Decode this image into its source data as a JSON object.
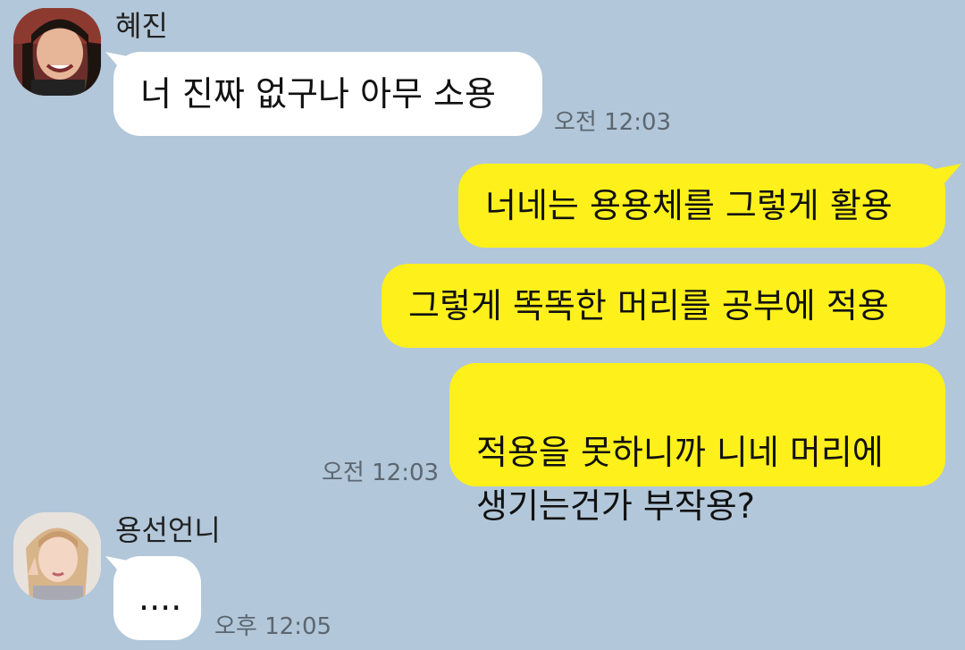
{
  "messages": [
    {
      "sender": "혜진",
      "text": "너 진짜 없구나 아무 소용",
      "time": "오전 12:03"
    },
    {
      "sender": "me",
      "lines": [
        "너네는 용용체를 그렇게 활용",
        "그렇게 똑똑한 머리를 공부에 적용",
        "적용을 못하니까 니네 머리에\n생기는건가 부작용?"
      ],
      "time": "오전 12:03"
    },
    {
      "sender": "용선언니",
      "text": "....",
      "time": "오후 12:05"
    }
  ],
  "avatars": {
    "hyejin": "profile-photo-icon",
    "yongsun": "profile-photo-icon"
  },
  "colors": {
    "background": "#b2c7d9",
    "incoming_bubble": "#ffffff",
    "outgoing_bubble": "#fef01b"
  }
}
